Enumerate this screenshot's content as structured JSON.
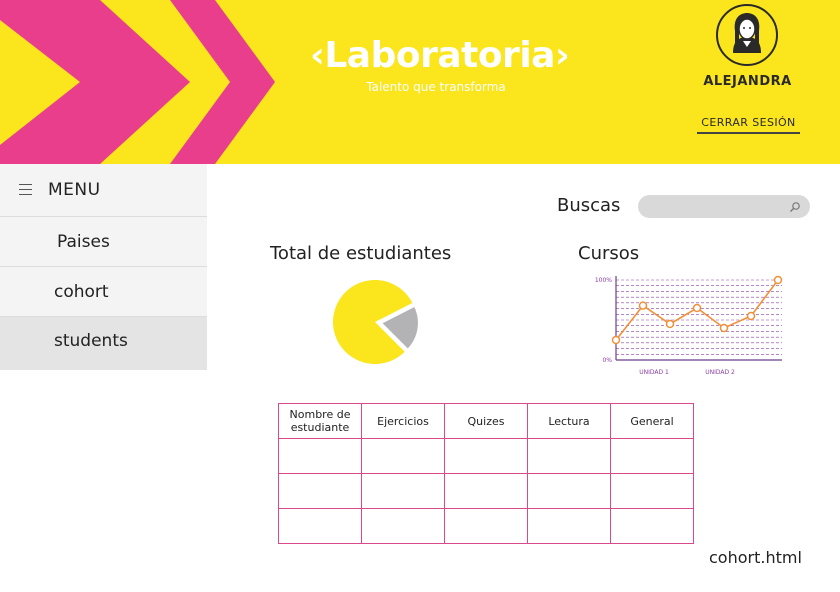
{
  "header": {
    "logo_title": "‹Laboratoria›",
    "logo_tagline": "Talento que transforma",
    "user_name": "ALEJANDRA",
    "logout_label": "CERRAR SESIÓN",
    "colors": {
      "background": "#fbe51c",
      "accent": "#e83e8c"
    }
  },
  "sidebar": {
    "menu_label": "MENU",
    "items": [
      {
        "label": "Paises",
        "active": false
      },
      {
        "label": "cohort",
        "active": false
      },
      {
        "label": "students",
        "active": true
      }
    ]
  },
  "search": {
    "label": "Buscas",
    "value": "",
    "icon": "search-icon"
  },
  "sections": {
    "students_title": "Total de estudiantes",
    "courses_title": "Cursos"
  },
  "table": {
    "headers": [
      "Nombre de estudiante",
      "Ejercicios",
      "Quizes",
      "Lectura",
      "General"
    ],
    "rows": [
      [
        "",
        "",
        "",
        "",
        ""
      ],
      [
        "",
        "",
        "",
        "",
        ""
      ],
      [
        "",
        "",
        "",
        "",
        ""
      ]
    ]
  },
  "footer": {
    "filename": "cohort.html"
  },
  "chart_data": [
    {
      "type": "pie",
      "title": "",
      "values": [
        80,
        20
      ],
      "colors": [
        "#fbe51c",
        "#b3b3b5"
      ]
    },
    {
      "type": "line",
      "title": "",
      "y_tick_labels": [
        "100%",
        "0%"
      ],
      "x_tick_labels": [
        "UNIDAD 1",
        "UNIDAD 2"
      ],
      "ylim": [
        0,
        100
      ],
      "grid": true,
      "series": [
        {
          "values": [
            25,
            68,
            45,
            65,
            40,
            55,
            100
          ],
          "color": "#f0913a"
        }
      ]
    }
  ]
}
